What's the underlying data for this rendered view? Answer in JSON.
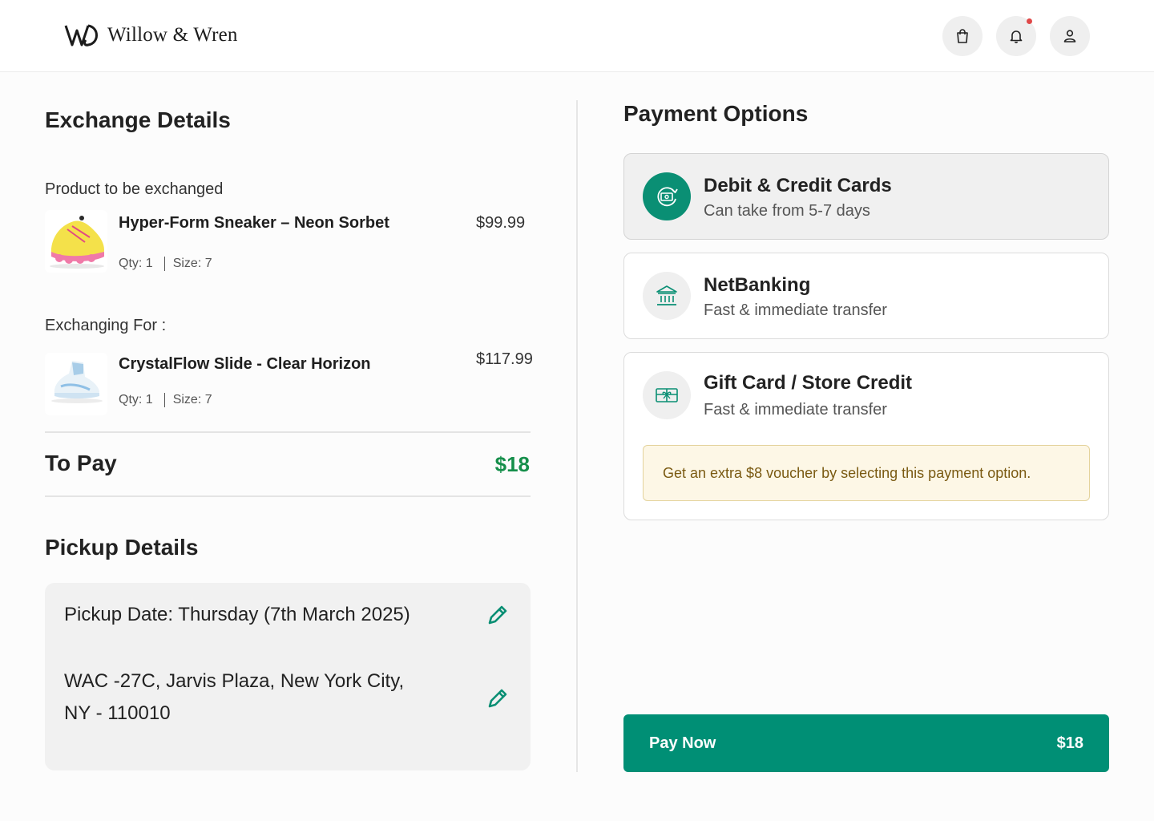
{
  "brand": {
    "name": "Willow & Wren"
  },
  "header": {
    "icons": [
      "shopping-bag-icon",
      "bell-icon",
      "user-icon"
    ],
    "notification_dot_color": "#e04848"
  },
  "exchange": {
    "title": "Exchange Details",
    "product_label": "Product to be exchanged",
    "product": {
      "name": "Hyper-Form Sneaker – Neon Sorbet",
      "price": "$99.99",
      "qty": "Qty: 1",
      "size": "Size: 7"
    },
    "for_label": "Exchanging For :",
    "new_product": {
      "name": "CrystalFlow Slide - Clear Horizon",
      "price": "$117.99",
      "qty": "Qty: 1",
      "size": "Size: 7"
    },
    "to_pay_label": "To Pay",
    "to_pay_amount": "$18"
  },
  "pickup": {
    "title": "Pickup Details",
    "date": "Pickup Date: Thursday (7th March 2025)",
    "address_line1": "WAC -27C, Jarvis Plaza, New York City,",
    "address_line2": "NY - 110010"
  },
  "payment": {
    "title": "Payment Options",
    "options": [
      {
        "title": "Debit & Credit Cards",
        "subtitle": "Can take from 5-7 days",
        "icon": "card-refund-icon",
        "selected": true
      },
      {
        "title": "NetBanking",
        "subtitle": "Fast & immediate transfer",
        "icon": "bank-icon",
        "selected": false
      },
      {
        "title": "Gift Card / Store Credit",
        "subtitle": "Fast & immediate transfer",
        "icon": "gift-card-icon",
        "selected": false
      }
    ],
    "voucher_note": "Get an extra $8 voucher by selecting this payment option."
  },
  "pay_button": {
    "label": "Pay Now",
    "amount": "$18"
  },
  "colors": {
    "accent": "#008f75",
    "to_pay_green": "#168f4b",
    "voucher_bg": "#fdf7e6"
  }
}
